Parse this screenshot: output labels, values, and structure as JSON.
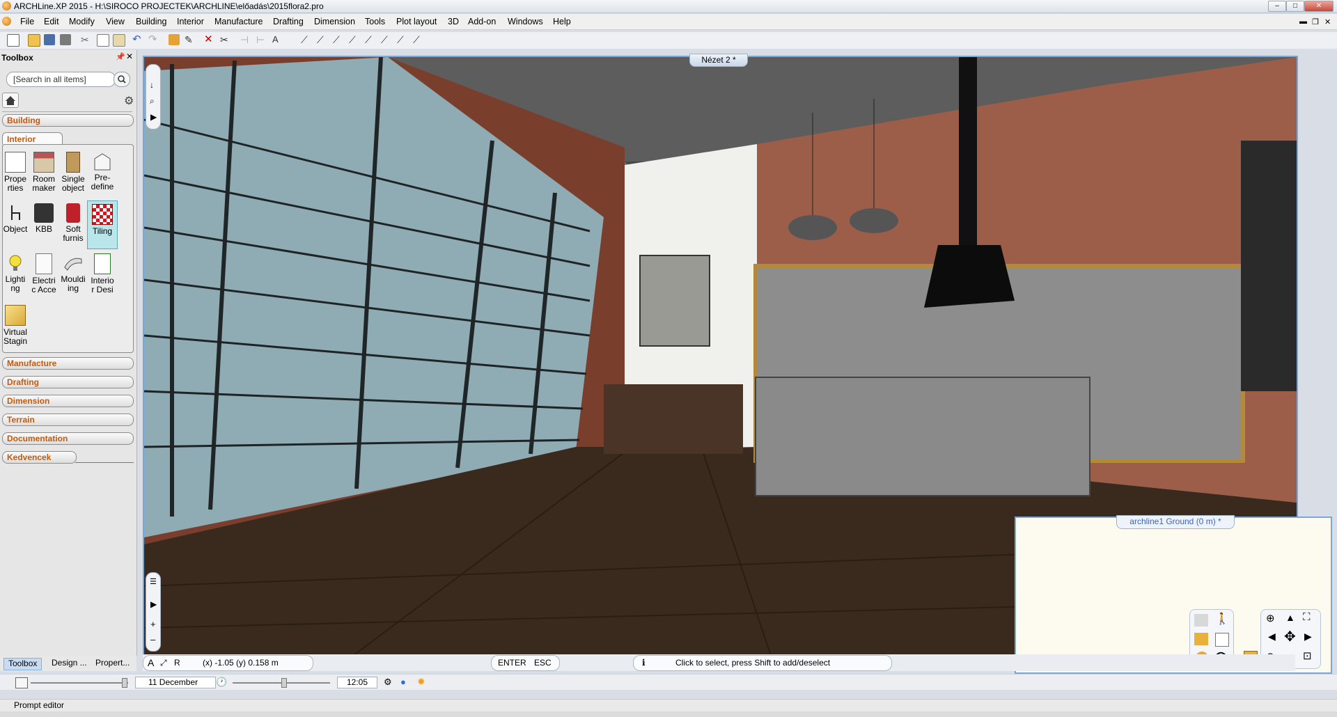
{
  "window": {
    "title": "ARCHLine.XP 2015 - H:\\SIROCO PROJECTEK\\ARCHLINE\\előadás\\2015flora2.pro"
  },
  "menu": [
    "File",
    "Edit",
    "Modify",
    "View",
    "Building",
    "Interior",
    "Manufacture",
    "Drafting",
    "Dimension",
    "Tools",
    "Plot layout",
    "3D",
    "Add-on",
    "Windows",
    "Help"
  ],
  "toolbox": {
    "title": "Toolbox",
    "search_placeholder": "[Search in all items]",
    "categories_top": [
      "Building"
    ],
    "active_tab": "Interior",
    "tools": [
      {
        "l1": "Prope",
        "l2": "rties"
      },
      {
        "l1": "Room",
        "l2": "maker"
      },
      {
        "l1": "Single",
        "l2": "object"
      },
      {
        "l1": "Pre-",
        "l2": "define"
      },
      {
        "l1": "Object",
        "l2": ""
      },
      {
        "l1": "KBB",
        "l2": ""
      },
      {
        "l1": "Soft",
        "l2": "furnis"
      },
      {
        "l1": "Tiling",
        "l2": ""
      },
      {
        "l1": "Lighti",
        "l2": "ng"
      },
      {
        "l1": "Electri",
        "l2": "c Acce"
      },
      {
        "l1": "Mouldi",
        "l2": "ing"
      },
      {
        "l1": "Interio",
        "l2": "r Desi"
      },
      {
        "l1": "Virtual",
        "l2": "Stagin"
      }
    ],
    "categories_bottom": [
      "Manufacture",
      "Drafting",
      "Dimension",
      "Terrain",
      "Documentation",
      "Kedvencek"
    ],
    "bottom_tabs": [
      "Toolbox",
      "Design ...",
      "Propert..."
    ]
  },
  "viewport": {
    "tab": "Nézet 2 *"
  },
  "statusbar": {
    "coords": "(x) -1.05    (y) 0.158 m",
    "enter": "ENTER",
    "esc": "ESC",
    "hint": "Click to select, press Shift to add/deselect"
  },
  "plan": {
    "tab": "archline1 Ground (0 m) *"
  },
  "timebar": {
    "date": "11 December",
    "time": "12:05"
  },
  "prompt": {
    "label": "Prompt editor"
  }
}
